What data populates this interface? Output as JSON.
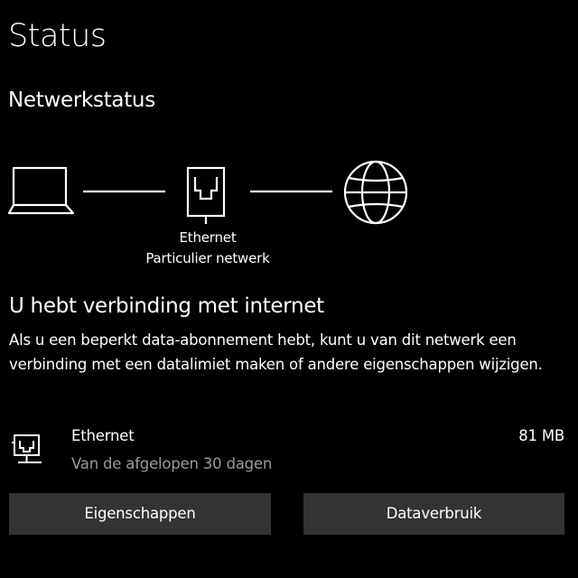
{
  "page": {
    "title": "Status",
    "section_title": "Netwerkstatus"
  },
  "diagram": {
    "adapter_name": "Ethernet",
    "network_type": "Particulier netwerk",
    "icons": [
      "laptop-icon",
      "ethernet-port-icon",
      "globe-icon"
    ]
  },
  "connection": {
    "status_title": "U hebt verbinding met internet",
    "description": "Als u een beperkt data-abonnement hebt, kunt u van dit netwerk een verbinding met een datalimiet maken of andere eigenschappen wijzigen."
  },
  "usage": {
    "icon": "ethernet-network-icon",
    "name": "Ethernet",
    "period": "Van de afgelopen 30 dagen",
    "amount": "81 MB"
  },
  "buttons": {
    "properties": "Eigenschappen",
    "data_usage": "Dataverbruik"
  },
  "colors": {
    "background": "#000000",
    "text": "#ffffff",
    "secondary_text": "#9a9a9a",
    "button_background": "#333333"
  }
}
